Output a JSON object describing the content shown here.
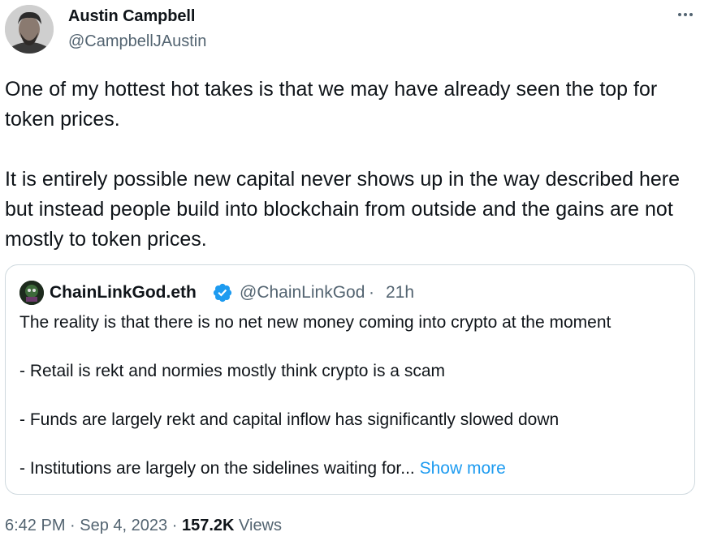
{
  "author": {
    "name": "Austin Campbell",
    "handle": "@CampbellJAustin"
  },
  "tweet": {
    "paragraph1": "One of my hottest hot takes is that we may have already seen the top for token prices.",
    "paragraph2": "It is entirely possible new capital never shows up in the way described here but instead people build into blockchain from outside and the gains are not mostly to token prices."
  },
  "quote": {
    "name": "ChainLinkGod.eth",
    "handle": "@ChainLinkGod",
    "separator": "·",
    "time": "21h",
    "lines": [
      "The reality is that there is no net new money coming into crypto at the moment",
      "- Retail is rekt and normies mostly think crypto is a scam",
      "- Funds are largely rekt and capital inflow has significantly slowed down",
      "- Institutions are largely on the sidelines waiting for..."
    ],
    "show_more": "Show more"
  },
  "meta": {
    "time": "6:42 PM",
    "date": "Sep 4, 2023",
    "separator": "·",
    "views_count": "157.2K",
    "views_label": "Views"
  },
  "colors": {
    "text": "#0f1419",
    "secondary": "#536471",
    "accent": "#1d9bf0",
    "border": "#cfd9de"
  },
  "icons": {
    "more": "more-dots-icon",
    "verified": "verified-badge-icon"
  }
}
